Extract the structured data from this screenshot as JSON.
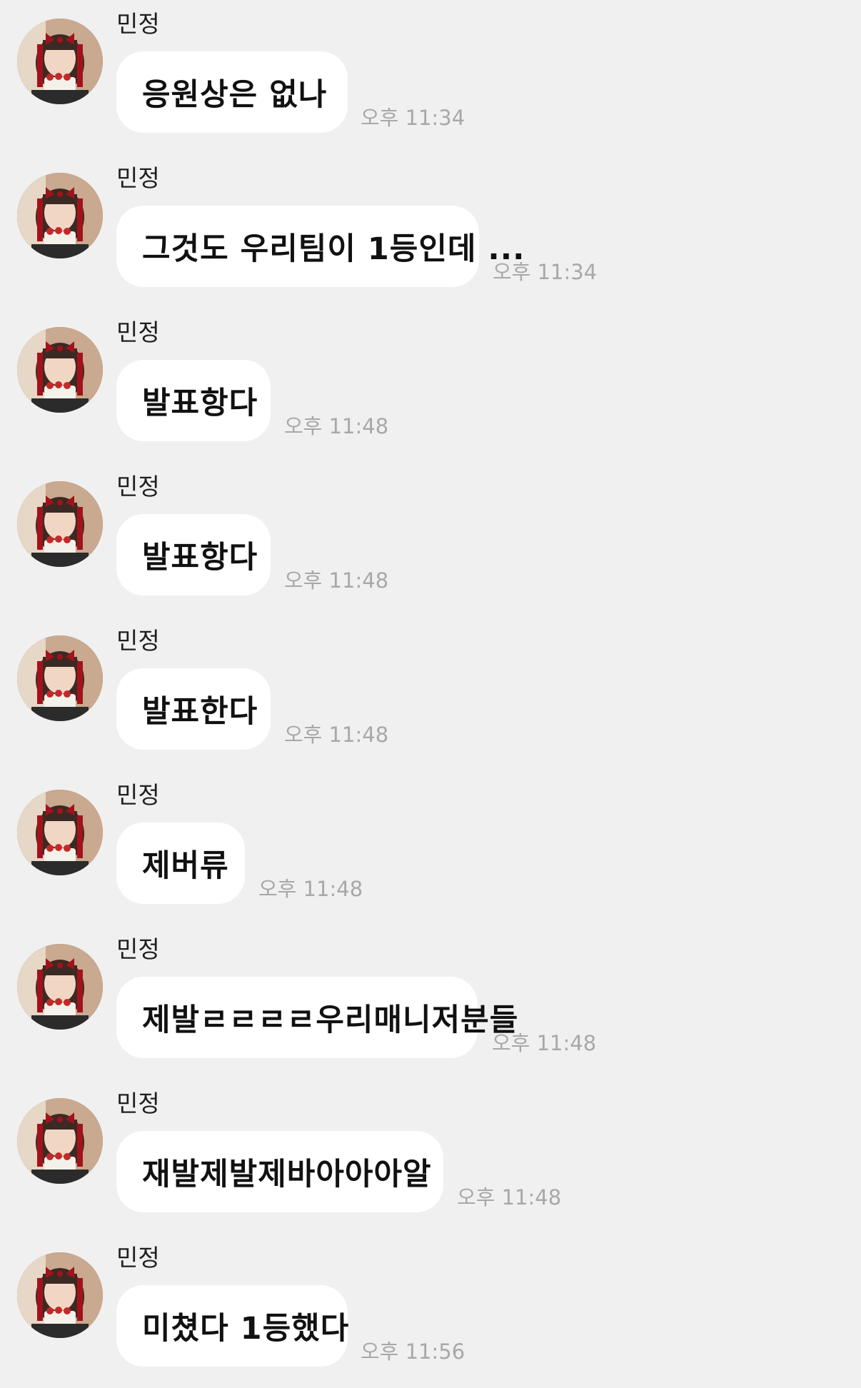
{
  "messages": [
    {
      "sender": "민정",
      "text": "응원상은 없나",
      "time": "오후 11:34"
    },
    {
      "sender": "민정",
      "text": "그것도 우리팀이 1등인데 ...",
      "time": "오후 11:34"
    },
    {
      "sender": "민정",
      "text": "발표항다",
      "time": "오후 11:48"
    },
    {
      "sender": "민정",
      "text": "발표항다",
      "time": "오후 11:48"
    },
    {
      "sender": "민정",
      "text": "발표한다",
      "time": "오후 11:48"
    },
    {
      "sender": "민정",
      "text": "제버류",
      "time": "오후 11:48"
    },
    {
      "sender": "민정",
      "text": "제발ㄹㄹㄹㄹ우리매니저분들",
      "time": "오후 11:48"
    },
    {
      "sender": "민정",
      "text": "재발제발제바아아아알",
      "time": "오후 11:48"
    },
    {
      "sender": "민정",
      "text": "미쳤다 1등했다",
      "time": "오후 11:56"
    }
  ],
  "colors": {
    "background": "#f0f0f0",
    "bubble": "#ffffff",
    "time_text": "#a8a8a8",
    "sender_text": "#1f1f1f"
  }
}
